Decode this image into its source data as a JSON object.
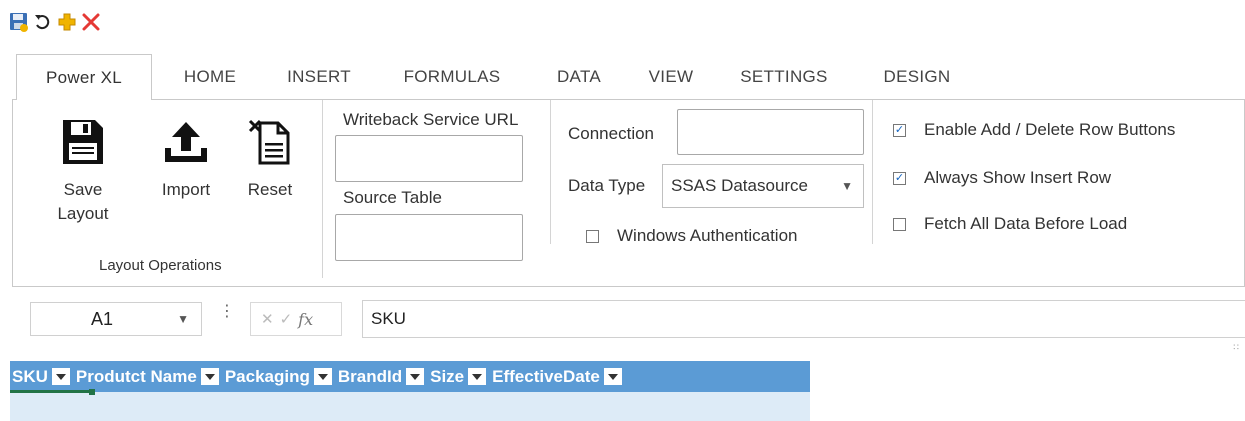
{
  "quick_access": [
    {
      "icon": "save-icon"
    },
    {
      "icon": "undo-icon"
    },
    {
      "icon": "add-icon"
    },
    {
      "icon": "delete-icon"
    }
  ],
  "tabs": [
    {
      "label": "Power XL",
      "active": true
    },
    {
      "label": "HOME",
      "active": false
    },
    {
      "label": "INSERT",
      "active": false
    },
    {
      "label": "FORMULAS",
      "active": false
    },
    {
      "label": "DATA",
      "active": false
    },
    {
      "label": "VIEW",
      "active": false
    },
    {
      "label": "SETTINGS",
      "active": false
    },
    {
      "label": "DESIGN",
      "active": false
    }
  ],
  "ribbon": {
    "layout_group": {
      "save_label": "Save\nLayout",
      "import_label": "Import",
      "reset_label": "Reset",
      "group_label": "Layout Operations"
    },
    "writeback": {
      "url_label": "Writeback Service URL",
      "url_value": "",
      "source_label": "Source Table",
      "source_value": ""
    },
    "connection": {
      "connection_label": "Connection",
      "connection_value": "",
      "data_type_label": "Data Type",
      "data_type_value": "SSAS Datasource",
      "windows_auth_label": "Windows Authentication",
      "windows_auth_checked": false
    },
    "options": {
      "enable_add_delete_label": "Enable Add / Delete Row Buttons",
      "enable_add_delete_checked": true,
      "always_show_insert_label": "Always Show Insert Row",
      "always_show_insert_checked": true,
      "fetch_all_label": "Fetch All Data Before Load",
      "fetch_all_checked": false
    }
  },
  "formula_bar": {
    "name_box": "A1",
    "cancel_symbol": "✕",
    "enter_symbol": "✓",
    "fx_label": "fx",
    "value": "SKU"
  },
  "grid": {
    "columns": [
      "SKU",
      "Produtct Name",
      "Packaging",
      "BrandId",
      "Size",
      "EffectiveDate"
    ]
  },
  "colors": {
    "header_bg": "#5b9bd5",
    "row_bg": "#ddebf7",
    "selection": "#217346",
    "delete_icon": "#e53935",
    "add_icon": "#f0b400"
  }
}
